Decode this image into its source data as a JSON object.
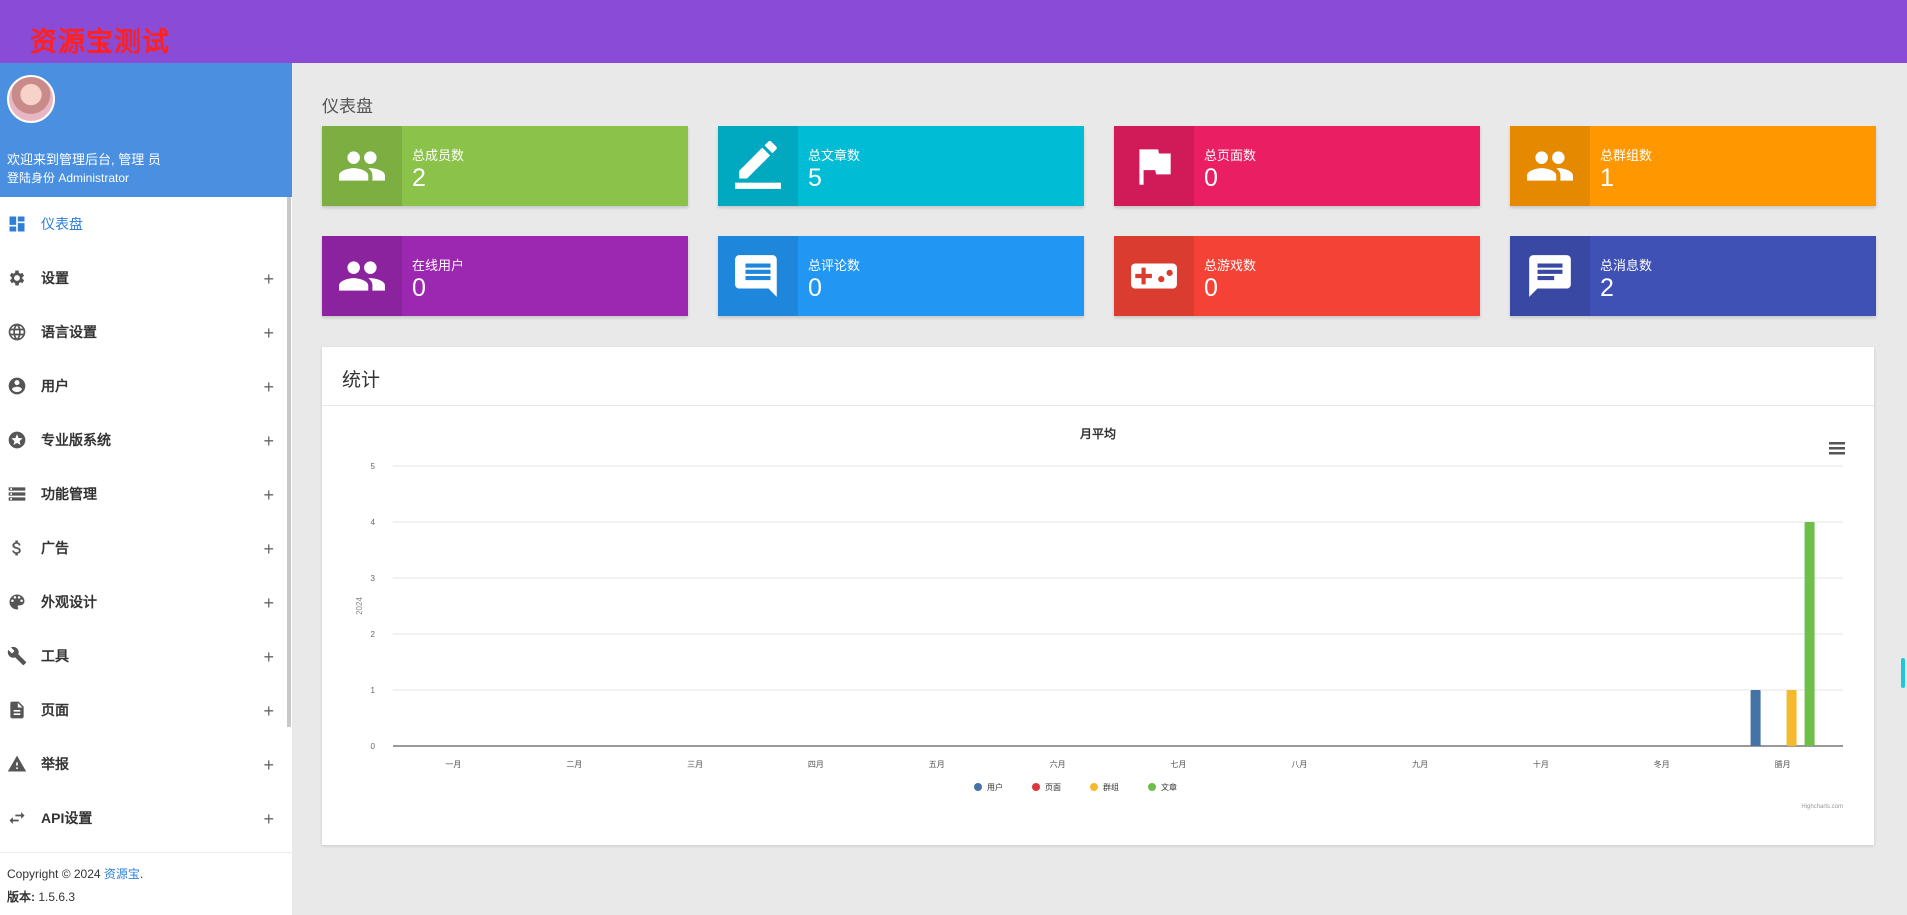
{
  "brand": "资源宝测试",
  "user": {
    "welcome": "欢迎来到管理后台, 管理 员",
    "role": "登陆身份 Administrator"
  },
  "menu": [
    {
      "label": "仪表盘",
      "icon": "dashboard-icon",
      "active": true
    },
    {
      "label": "设置",
      "icon": "gear-icon"
    },
    {
      "label": "语言设置",
      "icon": "globe-icon"
    },
    {
      "label": "用户",
      "icon": "user-icon"
    },
    {
      "label": "专业版系统",
      "icon": "star-icon"
    },
    {
      "label": "功能管理",
      "icon": "storage-icon"
    },
    {
      "label": "广告",
      "icon": "dollar-icon"
    },
    {
      "label": "外观设计",
      "icon": "palette-icon"
    },
    {
      "label": "工具",
      "icon": "wrench-icon"
    },
    {
      "label": "页面",
      "icon": "document-icon"
    },
    {
      "label": "举报",
      "icon": "warning-icon"
    },
    {
      "label": "API设置",
      "icon": "swap-icon"
    }
  ],
  "footer": {
    "copyright": "Copyright © 2024 ",
    "link": "资源宝",
    "dot": ".",
    "version_label": "版本:",
    "version": " 1.5.6.3"
  },
  "page_title": "仪表盘",
  "cards": [
    {
      "label": "总成员数",
      "value": "2",
      "icon": "people-icon",
      "color": "#8bc34a",
      "dark": "#7cae42"
    },
    {
      "label": "总文章数",
      "value": "5",
      "icon": "edit-icon",
      "color": "#00bcd4",
      "dark": "#00a9bf"
    },
    {
      "label": "总页面数",
      "value": "0",
      "icon": "flag-icon",
      "color": "#e91e63",
      "dark": "#d11b59"
    },
    {
      "label": "总群组数",
      "value": "1",
      "icon": "group-icon",
      "color": "#ff9800",
      "dark": "#e58900"
    },
    {
      "label": "在线用户",
      "value": "0",
      "icon": "people-icon",
      "color": "#9c27b0",
      "dark": "#8c239e"
    },
    {
      "label": "总评论数",
      "value": "0",
      "icon": "comment-icon",
      "color": "#2196f3",
      "dark": "#1e87db"
    },
    {
      "label": "总游戏数",
      "value": "0",
      "icon": "gamepad-icon",
      "color": "#f44336",
      "dark": "#db3c30"
    },
    {
      "label": "总消息数",
      "value": "2",
      "icon": "message-icon",
      "color": "#3f51b5",
      "dark": "#3949a3"
    }
  ],
  "panel_title": "统计",
  "chart_data": {
    "type": "bar",
    "title": "月平均",
    "ylabel": "2024",
    "ylim": [
      0,
      5
    ],
    "yticks": [
      0,
      1,
      2,
      3,
      4,
      5
    ],
    "categories": [
      "一月",
      "二月",
      "三月",
      "四月",
      "五月",
      "六月",
      "七月",
      "八月",
      "九月",
      "十月",
      "冬月",
      "腊月"
    ],
    "series": [
      {
        "name": "用户",
        "color": "#4572a7",
        "values": [
          0,
          0,
          0,
          0,
          0,
          0,
          0,
          0,
          0,
          0,
          0,
          1
        ]
      },
      {
        "name": "页面",
        "color": "#d9363e",
        "values": [
          0,
          0,
          0,
          0,
          0,
          0,
          0,
          0,
          0,
          0,
          0,
          0
        ]
      },
      {
        "name": "群组",
        "color": "#f5b92e",
        "values": [
          0,
          0,
          0,
          0,
          0,
          0,
          0,
          0,
          0,
          0,
          0,
          1
        ]
      },
      {
        "name": "文章",
        "color": "#6cc04a",
        "values": [
          0,
          0,
          0,
          0,
          0,
          0,
          0,
          0,
          0,
          0,
          0,
          4
        ]
      }
    ],
    "credit": "Highcharts.com",
    "legend": "bottom",
    "grid": true
  }
}
